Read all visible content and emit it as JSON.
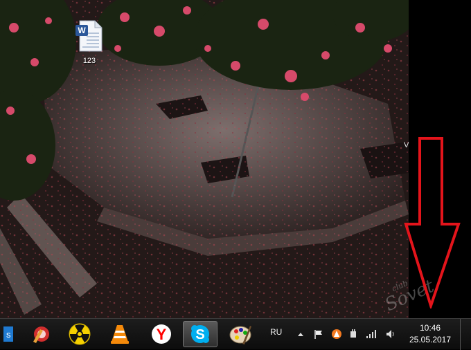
{
  "desktop": {
    "icons": [
      {
        "label": "123",
        "type": "word-document-icon"
      }
    ],
    "stray_text": "V",
    "watermark": {
      "line1": "club",
      "line2": "Sovet"
    }
  },
  "taskbar": {
    "pinned": [
      {
        "name": "ie-partial-icon"
      },
      {
        "name": "ccleaner-icon"
      },
      {
        "name": "radiation-app-icon"
      },
      {
        "name": "vlc-icon"
      },
      {
        "name": "yandex-browser-icon"
      },
      {
        "name": "skype-icon",
        "active": true
      },
      {
        "name": "paint-palette-icon"
      }
    ],
    "tray": {
      "language": "RU",
      "clock": {
        "time": "10:46",
        "date": "25.05.2017"
      }
    }
  },
  "colors": {
    "arrow": "#e3141b",
    "skype": "#00aff0",
    "yandex": "#ff0000"
  }
}
